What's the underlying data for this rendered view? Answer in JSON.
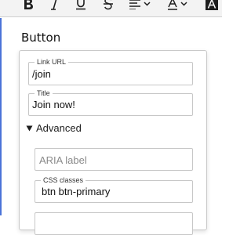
{
  "block": {
    "title": "Button"
  },
  "toolbar": {
    "icons": [
      "bold-icon",
      "italic-icon",
      "underline-icon",
      "strikethrough-icon",
      "align-icon",
      "font-color-icon",
      "highlight-icon"
    ]
  },
  "link_settings": {
    "url": {
      "label": "Link URL",
      "value": "/join"
    },
    "title": {
      "label": "Title",
      "value": "Join now!"
    },
    "advanced": {
      "label": "Advanced",
      "expanded": true
    },
    "aria_label": {
      "placeholder": "ARIA label",
      "value": ""
    },
    "css_classes": {
      "label": "CSS classes",
      "value": "btn btn-primary"
    }
  },
  "colors": {
    "focus_border": "#4a73d8",
    "text": "#1e1e1e",
    "placeholder": "#8a8a8a",
    "border": "#c7c7c7"
  }
}
